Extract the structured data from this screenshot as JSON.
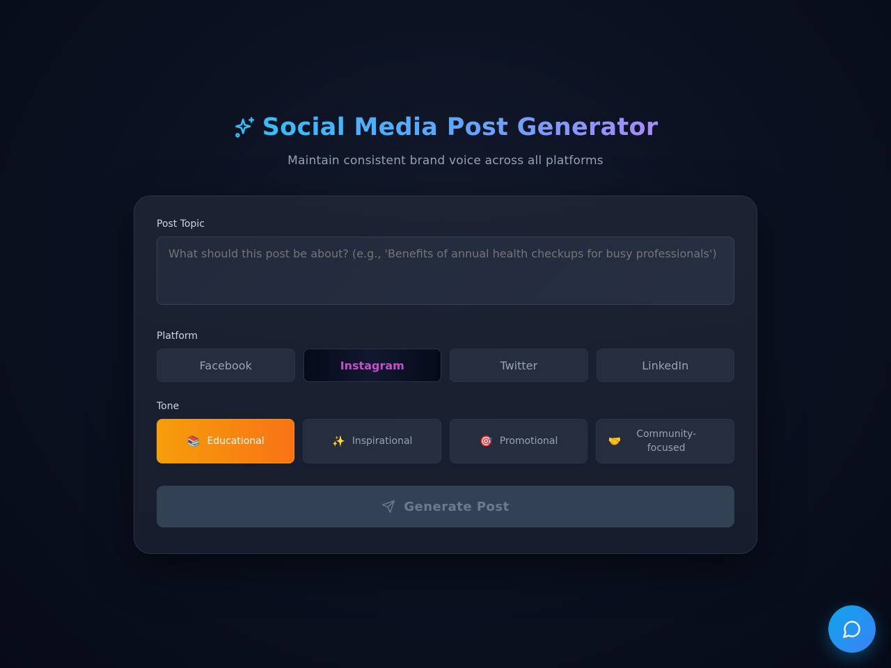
{
  "header": {
    "title": "Social Media Post Generator",
    "subtitle": "Maintain consistent brand voice across all platforms",
    "icon": "sparkles-icon"
  },
  "form": {
    "topic_label": "Post Topic",
    "topic_placeholder": "What should this post be about? (e.g., 'Benefits of annual health checkups for busy professionals')",
    "topic_value": "",
    "platform_label": "Platform",
    "platforms": [
      {
        "label": "Facebook",
        "active": false
      },
      {
        "label": "Instagram",
        "active": true
      },
      {
        "label": "Twitter",
        "active": false
      },
      {
        "label": "LinkedIn",
        "active": false
      }
    ],
    "tone_label": "Tone",
    "tones": [
      {
        "emoji": "📚",
        "label": "Educational",
        "active": true
      },
      {
        "emoji": "✨",
        "label": "Inspirational",
        "active": false
      },
      {
        "emoji": "🎯",
        "label": "Promotional",
        "active": false
      },
      {
        "emoji": "🤝",
        "label": "Community-focused",
        "active": false
      }
    ],
    "generate_label": "Generate Post",
    "generate_icon": "send-icon"
  },
  "chat": {
    "icon": "chat-bubble-icon"
  },
  "colors": {
    "accent_title_start": "#38bdf8",
    "accent_title_end": "#a78bfa",
    "active_platform_text": "#c44fc9",
    "active_tone_start": "#f59e0b",
    "active_tone_end": "#f97316",
    "chat_fab": "#0ea5e9"
  }
}
